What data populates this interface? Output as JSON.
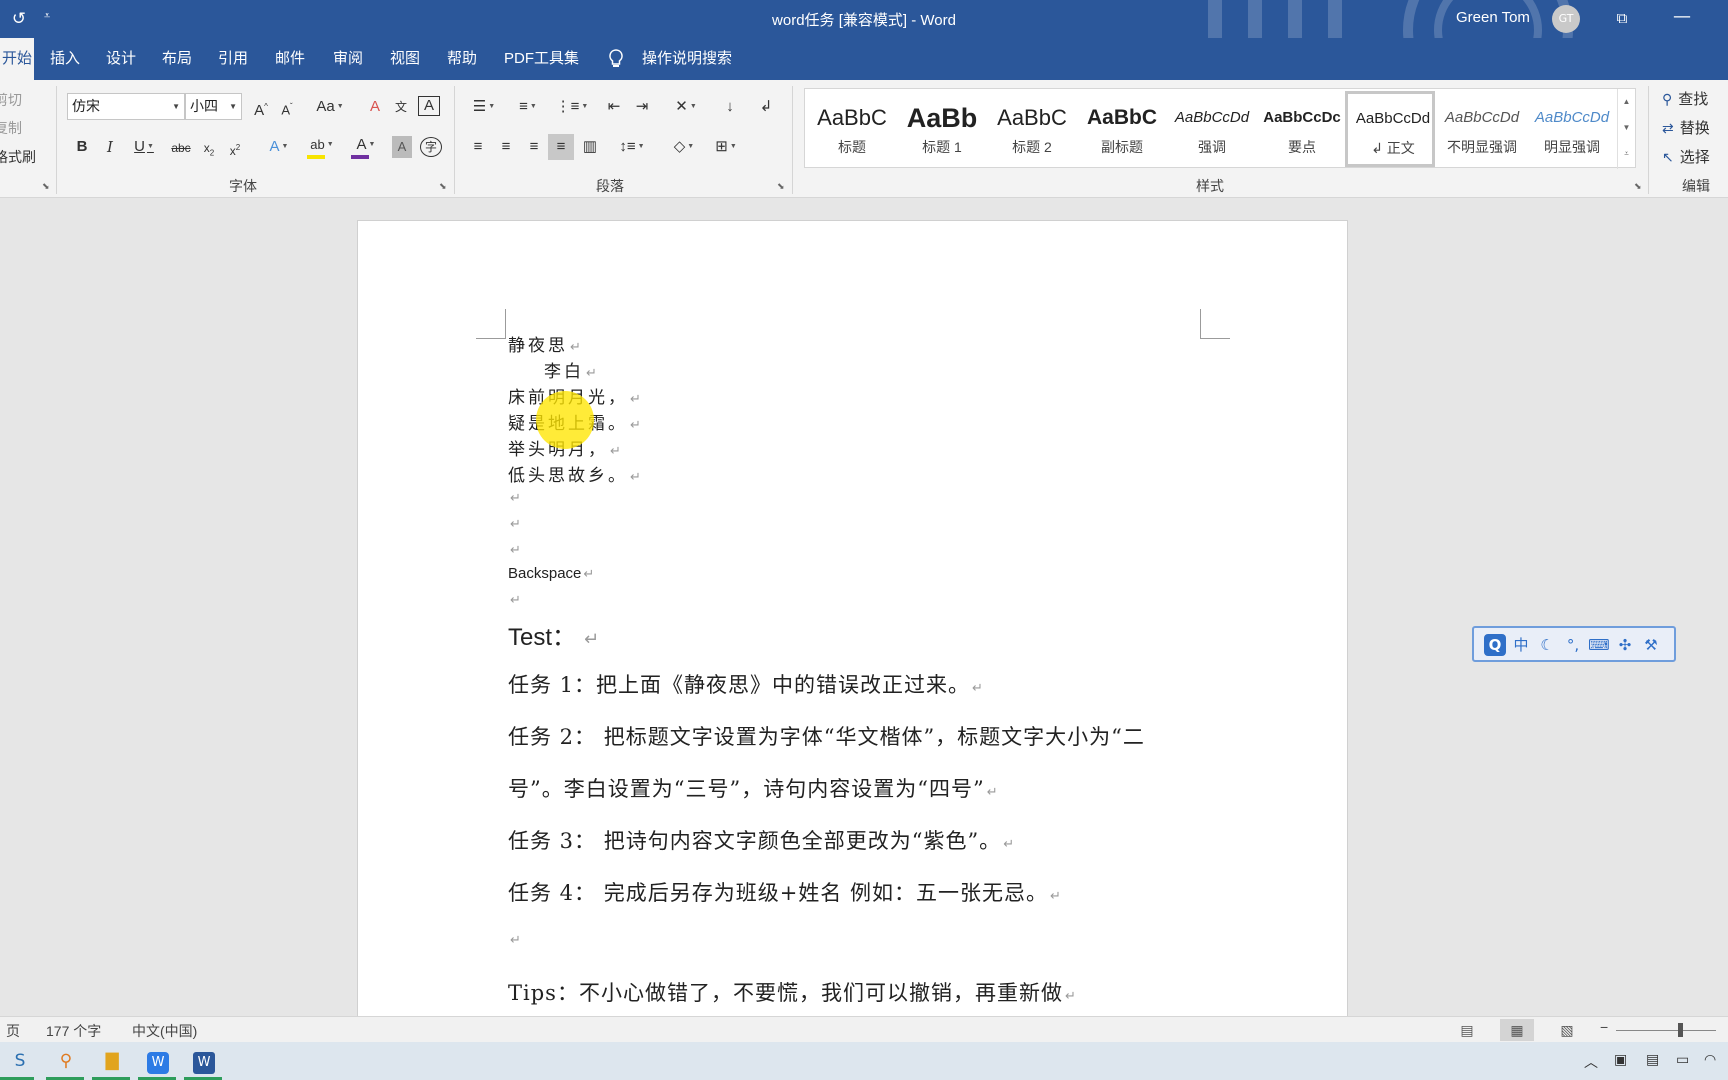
{
  "window": {
    "title": "word任务 [兼容模式]  -  Word",
    "user_name": "Green Tom",
    "user_initials": "GT",
    "undo_icon": "↺",
    "qat_icon": "⩡",
    "ribbon_display_icon": "⧉",
    "minimize_icon": "—"
  },
  "tabs": [
    {
      "label": "开始",
      "active": true
    },
    {
      "label": "插入"
    },
    {
      "label": "设计"
    },
    {
      "label": "布局"
    },
    {
      "label": "引用"
    },
    {
      "label": "邮件"
    },
    {
      "label": "审阅"
    },
    {
      "label": "视图"
    },
    {
      "label": "帮助"
    },
    {
      "label": "PDF工具集"
    }
  ],
  "tell_me": {
    "label": "操作说明搜索",
    "icon": "lightbulb-icon"
  },
  "clipboard": {
    "cut": "剪切",
    "copy": "复制",
    "format_painter": "格式刷"
  },
  "font": {
    "name": "仿宋",
    "size": "小四",
    "group_label": "字体"
  },
  "paragraph": {
    "group_label": "段落"
  },
  "styles": {
    "group_label": "样式",
    "items": [
      {
        "preview": "AaBbC",
        "name": "标题"
      },
      {
        "preview": "AaBb",
        "name": "标题 1"
      },
      {
        "preview": "AaBbC",
        "name": "标题 2"
      },
      {
        "preview": "AaBbC",
        "name": "副标题"
      },
      {
        "preview": "AaBbCcDd",
        "name": "强调"
      },
      {
        "preview": "AaBbCcDc",
        "name": "要点"
      },
      {
        "preview": "AaBbCcDd",
        "name": "↲ 正文",
        "selected": true
      },
      {
        "preview": "AaBbCcDd",
        "name": "不明显强调"
      },
      {
        "preview": "AaBbCcDd",
        "name": "明显强调"
      }
    ]
  },
  "editing": {
    "find": "查找",
    "replace": "替换",
    "select": "选择",
    "group_label": "编辑"
  },
  "document": {
    "poem_title": "静夜思",
    "author": "李白",
    "lines": [
      "床前明月光，",
      "疑是地上霜。",
      "举头明月，",
      "低头思故乡。"
    ],
    "para_mark": "↵",
    "backspace_text": "Backspace",
    "test_heading": "Test：",
    "task1": "任务 1：把上面《静夜思》中的错误改正过来。",
    "task2_line1": "任务 2：  把标题文字设置为字体“华文楷体”，标题文字大小为“二",
    "task2_line2": "号”。李白设置为“三号”，诗句内容设置为“四号”",
    "task3": "任务 3：  把诗句内容文字颜色全部更改为“紫色”。",
    "task4": "任务 4：  完成后另存为班级+姓名  例如：五一张无忌。",
    "tips": "Tips：不小心做错了，不要慌，我们可以撤销，再重新做"
  },
  "statusbar": {
    "page_label": "页",
    "word_count": "177 个字",
    "language": "中文(中国)",
    "zoom_minus": "−"
  },
  "ime": {
    "logo": "Q",
    "mode": "中"
  },
  "colors": {
    "accent": "#2b579a",
    "highlight": "#f7e400",
    "font_color_bar": "#7030a0"
  }
}
